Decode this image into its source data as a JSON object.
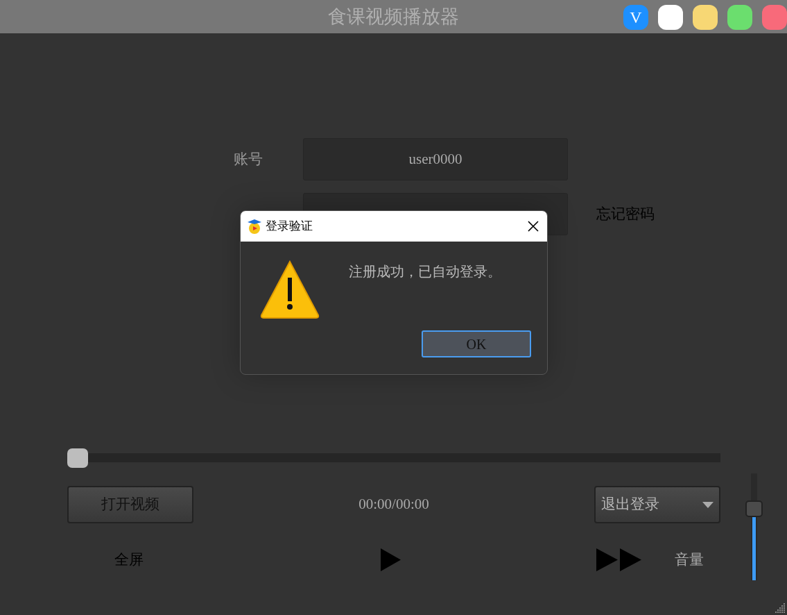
{
  "window": {
    "title": "食课视频播放器",
    "buttons": [
      {
        "kind": "v",
        "label": "V",
        "color": "#1e90ff"
      },
      {
        "kind": "dot",
        "color": "#ffffff"
      },
      {
        "kind": "dot",
        "color": "#f7d774"
      },
      {
        "kind": "dot",
        "color": "#6bde6e"
      },
      {
        "kind": "dot",
        "color": "#f86a7a"
      }
    ]
  },
  "login": {
    "account_label": "账号",
    "account_value": "user0000",
    "forgot_link": "忘记密码"
  },
  "dialog": {
    "title": "登录验证",
    "message": "注册成功，已自动登录。",
    "ok": "OK"
  },
  "player": {
    "progress": {
      "level": 0
    },
    "open_button": "打开视频",
    "time": "00:00/00:00",
    "account_menu": "退出登录",
    "fullscreen": "全屏",
    "volume_label": "音量",
    "volume": {
      "level": 0.67
    }
  }
}
